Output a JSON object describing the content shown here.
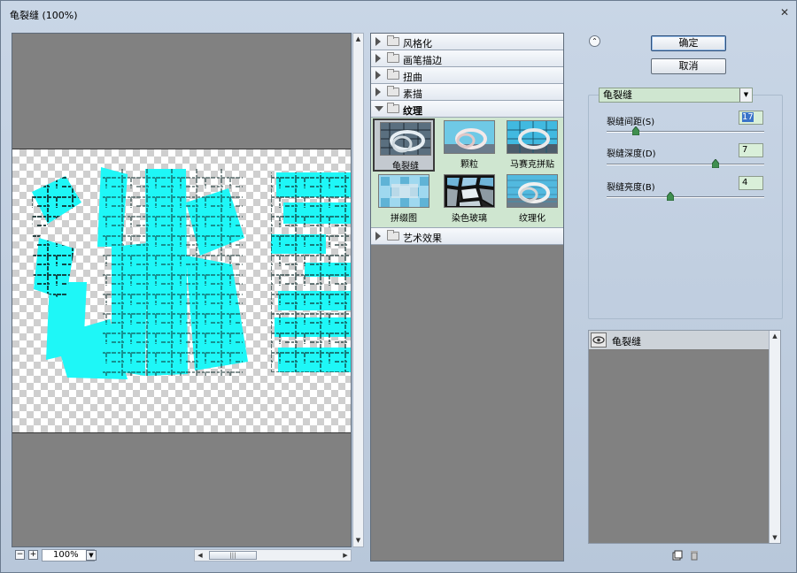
{
  "window": {
    "title": "龟裂缝 (100%)"
  },
  "preview": {
    "zoom": "100%",
    "zoom_out_label": "−",
    "zoom_in_label": "+",
    "art_colors": {
      "fill": "#1ef7f7",
      "crack": "#0d2a2a"
    }
  },
  "gallery": {
    "categories_top": [
      {
        "label": "风格化"
      },
      {
        "label": "画笔描边"
      },
      {
        "label": "扭曲"
      },
      {
        "label": "素描"
      }
    ],
    "open_category": {
      "label": "纹理"
    },
    "thumbs": [
      {
        "label": "龟裂缝",
        "icon": "craquelure-thumbnail",
        "selected": true
      },
      {
        "label": "颗粒",
        "icon": "grain-thumbnail",
        "selected": false
      },
      {
        "label": "马赛克拼贴",
        "icon": "mosaic-tiles-thumbnail",
        "selected": false
      },
      {
        "label": "拼缀图",
        "icon": "patchwork-thumbnail",
        "selected": false
      },
      {
        "label": "染色玻璃",
        "icon": "stained-glass-thumbnail",
        "selected": false
      },
      {
        "label": "纹理化",
        "icon": "texturizer-thumbnail",
        "selected": false
      }
    ],
    "categories_bottom": [
      {
        "label": "艺术效果"
      }
    ]
  },
  "buttons": {
    "ok": "确定",
    "cancel": "取消"
  },
  "filter": {
    "selected": "龟裂缝",
    "params": [
      {
        "label": "裂缝间距(S)",
        "value": "17",
        "fraction": 0.17,
        "focused": true
      },
      {
        "label": "裂缝深度(D)",
        "value": "7",
        "fraction": 0.7,
        "focused": false
      },
      {
        "label": "裂缝亮度(B)",
        "value": "4",
        "fraction": 0.4,
        "focused": false
      }
    ]
  },
  "layers": {
    "items": [
      {
        "name": "龟裂缝",
        "visible": true
      }
    ]
  }
}
